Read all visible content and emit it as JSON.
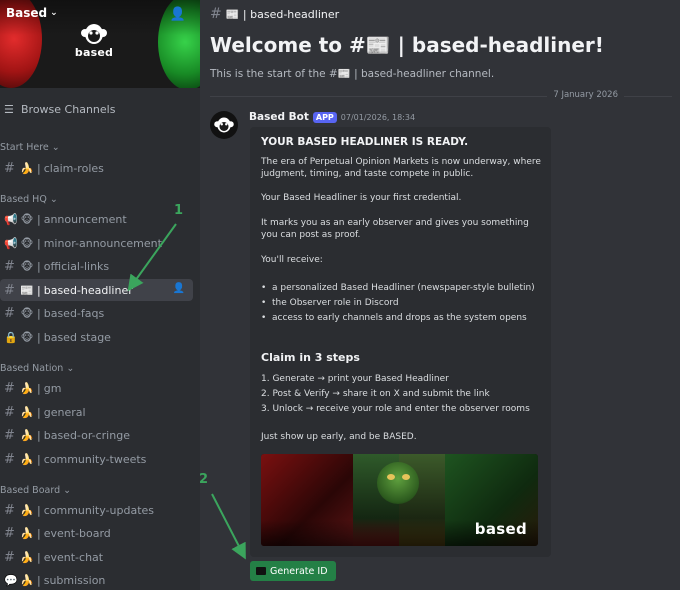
{
  "server": {
    "name": "Based",
    "logo_text": "based"
  },
  "sidebar": {
    "browse_label": "Browse Channels",
    "categories": [
      {
        "name": "Start Here",
        "channels": [
          {
            "emoji": "🍌",
            "name": "claim-roles",
            "icon": "hash-icon"
          }
        ]
      },
      {
        "name": "Based HQ",
        "channels": [
          {
            "emoji": "🐵",
            "name": "announcement",
            "icon": "announcement-icon"
          },
          {
            "emoji": "🐵",
            "name": "minor-announcement",
            "icon": "announcement-icon"
          },
          {
            "emoji": "🐵",
            "name": "official-links",
            "icon": "hash-icon"
          },
          {
            "emoji": "📰",
            "name": "based-headliner",
            "icon": "hash-icon",
            "selected": true
          },
          {
            "emoji": "🐵",
            "name": "based-faqs",
            "icon": "hash-icon"
          },
          {
            "emoji": "🐵",
            "name": "based stage",
            "icon": "lock-icon"
          }
        ]
      },
      {
        "name": "Based Nation",
        "channels": [
          {
            "emoji": "🍌",
            "name": "gm",
            "icon": "hash-icon"
          },
          {
            "emoji": "🍌",
            "name": "general",
            "icon": "hash-icon"
          },
          {
            "emoji": "🍌",
            "name": "based-or-cringe",
            "icon": "hash-icon"
          },
          {
            "emoji": "🍌",
            "name": "community-tweets",
            "icon": "hash-icon"
          }
        ]
      },
      {
        "name": "Based Board",
        "channels": [
          {
            "emoji": "🍌",
            "name": "community-updates",
            "icon": "hash-icon"
          },
          {
            "emoji": "🍌",
            "name": "event-board",
            "icon": "hash-icon"
          },
          {
            "emoji": "🍌",
            "name": "event-chat",
            "icon": "hash-icon"
          },
          {
            "emoji": "🍌",
            "name": "submission",
            "icon": "forum-icon"
          }
        ]
      }
    ]
  },
  "channel": {
    "topbar": "📰 | based-headliner",
    "welcome": "Welcome to #📰 | based-headliner!",
    "welcome_sub": "This is the start of the #📰 | based-headliner channel.",
    "date_divider": "7 January 2026"
  },
  "message": {
    "author": "Based Bot",
    "badge": "APP",
    "timestamp": "07/01/2026, 18:34",
    "embed": {
      "title": "YOUR BASED HEADLINER IS READY.",
      "p1": "The era of Perpetual Opinion Markets is now underway, where judgment, timing, and taste compete in public.",
      "p2": "Your Based Headliner is your first credential.",
      "p3": "It marks you as an early observer and gives you something you can post as proof.",
      "p4": "You'll receive:",
      "bullets": [
        "a personalized Based Headliner (newspaper-style bulletin)",
        "the Observer role in Discord",
        "access to early channels and drops as the system opens"
      ],
      "claim_title": "Claim in 3 steps",
      "steps": [
        "1. Generate → print your Based Headliner",
        "2. Post & Verify → share it on X and submit the link",
        "3. Unlock → receive your role and enter the observer rooms"
      ],
      "closing": "Just show up early, and be BASED.",
      "image_text": "based"
    },
    "button": "Generate ID"
  },
  "annotations": {
    "n1": "1",
    "n2": "2",
    "color": "#3ba55d"
  },
  "colors": {
    "accent": "#5865f2",
    "button": "#248046",
    "sidebar": "#2b2d31",
    "main": "#313338"
  }
}
